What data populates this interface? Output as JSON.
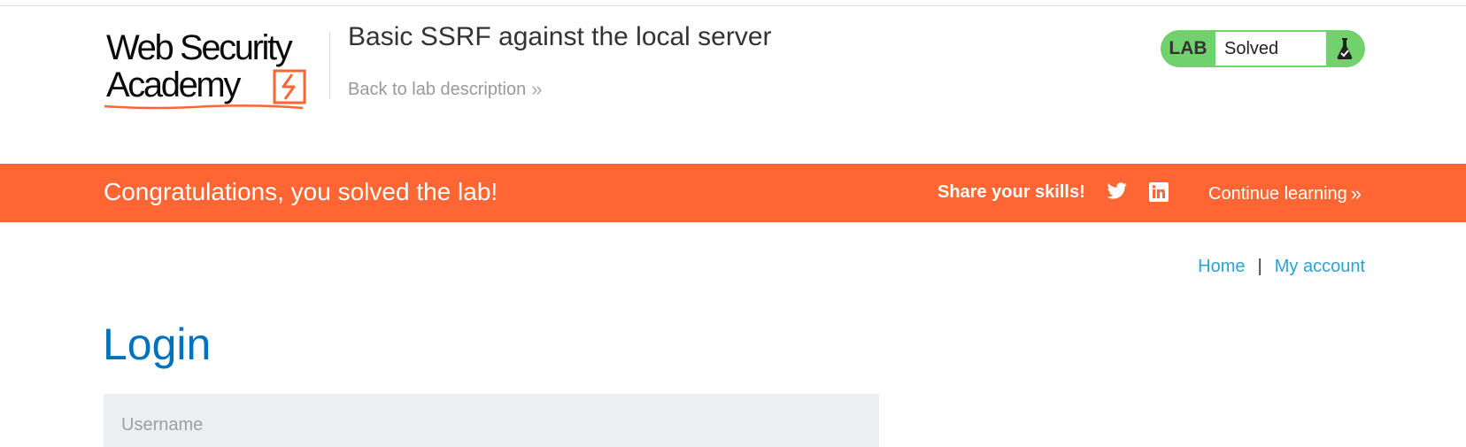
{
  "header": {
    "logo": {
      "line1": "Web Security",
      "line2": "Academy",
      "accent": "#ff6633"
    },
    "lab_title": "Basic SSRF against the local server",
    "back_link": "Back to lab description",
    "back_icon": "chevron-double-right-icon",
    "lab_status": {
      "label": "LAB",
      "value": "Solved",
      "color": "#70d16d",
      "icon": "flask-icon"
    }
  },
  "banner": {
    "message": "Congratulations, you solved the lab!",
    "share_label": "Share your skills!",
    "social_icons": [
      "twitter-icon",
      "linkedin-icon"
    ],
    "continue_label": "Continue learning",
    "color": "#ff6633"
  },
  "nav": {
    "home": "Home",
    "separator": "|",
    "account": "My account",
    "link_color": "#29a3d6"
  },
  "main": {
    "heading": "Login",
    "heading_color": "#0071bc",
    "username_placeholder": "Username"
  }
}
